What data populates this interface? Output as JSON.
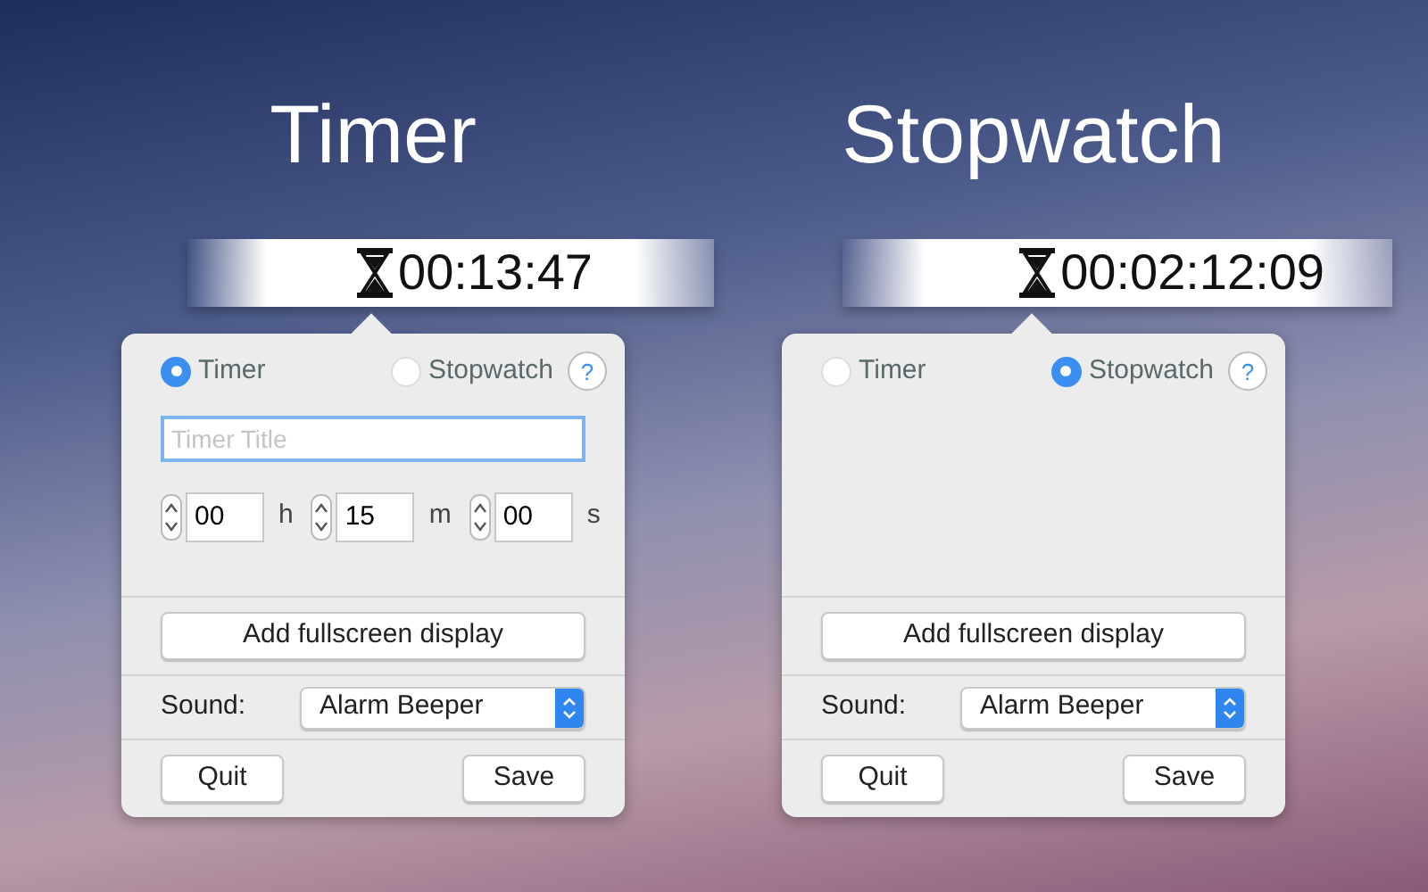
{
  "panels": [
    {
      "heading": "Timer",
      "clock": "00:13:47",
      "modes": [
        {
          "label": "Timer",
          "selected": true
        },
        {
          "label": "Stopwatch",
          "selected": false
        }
      ],
      "help": "?",
      "title_field": {
        "placeholder": "Timer Title"
      },
      "time_fields": [
        {
          "value": "00",
          "unit": "h"
        },
        {
          "value": "15",
          "unit": "m"
        },
        {
          "value": "00",
          "unit": "s"
        }
      ],
      "fullscreen_button": "Add fullscreen display",
      "sound_label": "Sound:",
      "sound_value": "Alarm Beeper",
      "quit": "Quit",
      "save": "Save"
    },
    {
      "heading": "Stopwatch",
      "clock": "00:02:12:09",
      "modes": [
        {
          "label": "Timer",
          "selected": false
        },
        {
          "label": "Stopwatch",
          "selected": true
        }
      ],
      "help": "?",
      "fullscreen_button": "Add fullscreen display",
      "sound_label": "Sound:",
      "sound_value": "Alarm Beeper",
      "quit": "Quit",
      "save": "Save"
    }
  ]
}
